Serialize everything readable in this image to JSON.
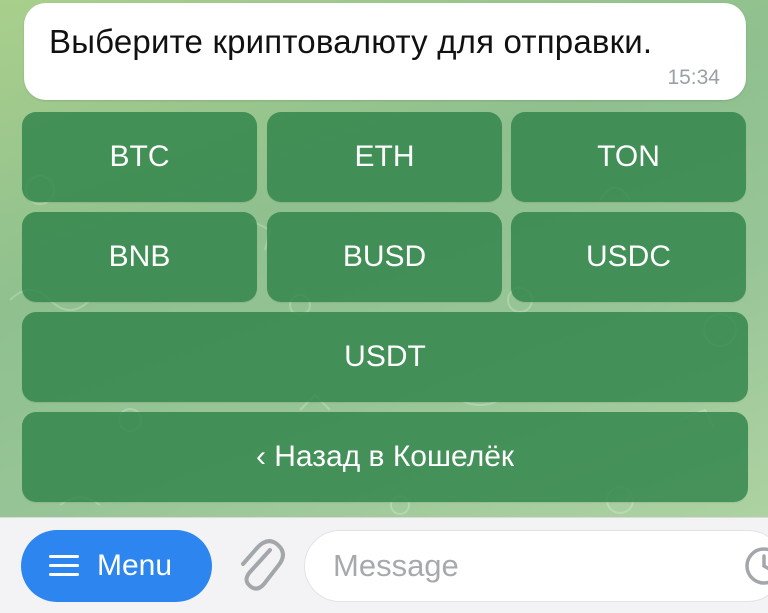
{
  "message": {
    "text": "Выберите криптовалюту для отправки.",
    "time": "15:34"
  },
  "keyboard": {
    "rows": [
      [
        "BTC",
        "ETH",
        "TON"
      ],
      [
        "BNB",
        "BUSD",
        "USDC"
      ],
      [
        "USDT"
      ],
      [
        "‹ Назад в Кошелёк"
      ]
    ]
  },
  "input_bar": {
    "menu_label": "Menu",
    "message_placeholder": "Message",
    "icons": [
      "menu-icon",
      "paperclip-icon",
      "clock-icon"
    ]
  },
  "colors": {
    "button_bg": "#2f844a",
    "menu_button_bg": "#2d86f0",
    "bubble_bg": "#ffffff"
  }
}
